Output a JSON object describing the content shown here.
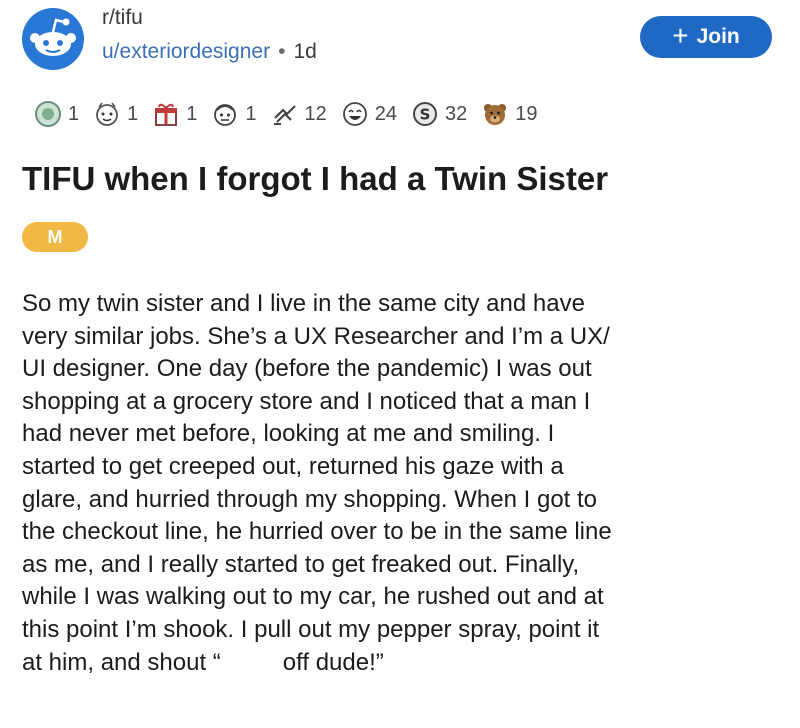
{
  "post": {
    "subreddit": "r/tifu",
    "author": "u/exteriordesigner",
    "separator": "•",
    "age": "1d",
    "join_label": "Join",
    "join_icon": "plus-icon",
    "title": "TIFU when I forgot I had a Twin Sister",
    "flair": "M",
    "flair_color": "#f2b844",
    "accent_color": "#1f68c4",
    "body_lines": [
      "So my twin sister and I live in the same city and have",
      "very similar jobs. She’s a UX Researcher and I’m a UX/",
      "UI designer. One day (before the pandemic) I was out",
      "shopping at a grocery store and I noticed that a man I",
      "had never met before, looking at me and smiling. I",
      "started to get creeped out, returned his gaze with a",
      "glare, and hurried through my shopping. When I got to",
      "the checkout line, he hurried over to be in the same line",
      "as me, and I really started to get freaked out. Finally,",
      "while I was walking out to my car, he rushed out and at",
      "this point I’m shook. I pull out my pepper spray, point it"
    ],
    "body_last_start": "at him, and shout “",
    "body_last_end": "off dude!”"
  },
  "awards": [
    {
      "icon": "helpful-award-icon",
      "count": "1"
    },
    {
      "icon": "wholesome-award-icon",
      "count": "1"
    },
    {
      "icon": "gift-award-icon",
      "count": "1"
    },
    {
      "icon": "face-award-icon",
      "count": "1"
    },
    {
      "icon": "hands-award-icon",
      "count": "12"
    },
    {
      "icon": "laughing-award-icon",
      "count": "24"
    },
    {
      "icon": "silver-award-icon",
      "count": "32"
    },
    {
      "icon": "bear-award-icon",
      "count": "19"
    }
  ]
}
